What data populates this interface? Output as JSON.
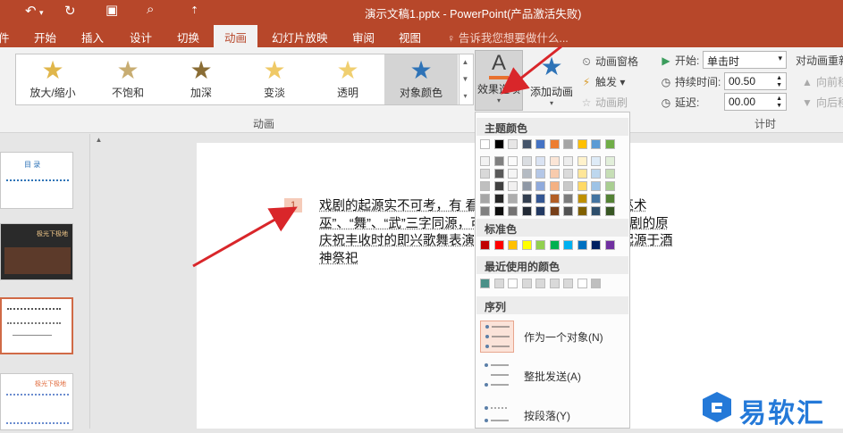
{
  "titlebar": {
    "title": "演示文稿1.pptx - PowerPoint(产品激活失败)",
    "undo_icon": "undo-icon",
    "redo_icon": "redo-icon"
  },
  "tabs": [
    {
      "label": "开始"
    },
    {
      "label": "插入"
    },
    {
      "label": "设计"
    },
    {
      "label": "切换"
    },
    {
      "label": "动画"
    },
    {
      "label": "幻灯片放映"
    },
    {
      "label": "审阅"
    },
    {
      "label": "视图"
    }
  ],
  "tellme": "告诉我您想要做什么...",
  "gallery": {
    "effects": [
      {
        "label": "放大/缩小",
        "color": "#e0b64a"
      },
      {
        "label": "不饱和",
        "color": "#c8ad72"
      },
      {
        "label": "加深",
        "color": "#8a6d35"
      },
      {
        "label": "变淡",
        "color": "#efc966"
      },
      {
        "label": "透明",
        "color": "#f0cf70"
      },
      {
        "label": "对象颜色",
        "color": "#2e73b7"
      }
    ]
  },
  "ribbon": {
    "effect_options_label": "效果选项",
    "add_animation_label": "添加动画",
    "animation_pane_label": "动画窗格",
    "trigger_label": "触发",
    "animation_painter_label": "动画刷",
    "group_animation": "动画",
    "start_label": "开始:",
    "start_value": "单击时",
    "duration_label": "持续时间:",
    "duration_value": "00.50",
    "delay_label": "延迟:",
    "delay_value": "00.00",
    "group_timing": "计时",
    "reorder_label": "对动画重新",
    "move_earlier": "向前移",
    "move_later": "向后移"
  },
  "dropdown": {
    "theme_colors_title": "主题颜色",
    "standard_colors_title": "标准色",
    "recent_colors_title": "最近使用的颜色",
    "sequence_title": "序列",
    "theme_top": [
      "#ffffff",
      "#000000",
      "#e7e6e6",
      "#44546a",
      "#4472c4",
      "#ed7d31",
      "#a5a5a5",
      "#ffc000",
      "#5b9bd5",
      "#70ad47"
    ],
    "standard": [
      "#c00000",
      "#ff0000",
      "#ffc000",
      "#ffff00",
      "#92d050",
      "#00b050",
      "#00b0f0",
      "#0070c0",
      "#002060",
      "#7030a0"
    ],
    "recent": [
      "#4a9088",
      "#d9d9d9",
      "#ffffff",
      "#d9d9d9",
      "#d9d9d9",
      "#d9d9d9",
      "#d9d9d9",
      "#ffffff",
      "#bfbfbf"
    ],
    "sequence": [
      {
        "label": "作为一个对象(N)"
      },
      {
        "label": "整批发送(A)"
      },
      {
        "label": "按段落(Y)"
      }
    ]
  },
  "slide": {
    "badge": "1",
    "text": "戏剧的起源实不可考，有 看法有二：一为原始宗教的巫术 巫”、“舞”、“武”三字同源，可 的巫术活动的合称，即戏剧的原 庆祝丰收时的即兴歌舞表演，这种 戏剧，它被认为是起源于酒神祭祀"
  },
  "thumbs": [
    {
      "text": "目 录"
    },
    {
      "text": "极光下极地"
    },
    {
      "text": ""
    },
    {
      "text": "极光下极地"
    }
  ],
  "watermark": {
    "text": "易软汇",
    "brand_color": "#2479d8"
  }
}
